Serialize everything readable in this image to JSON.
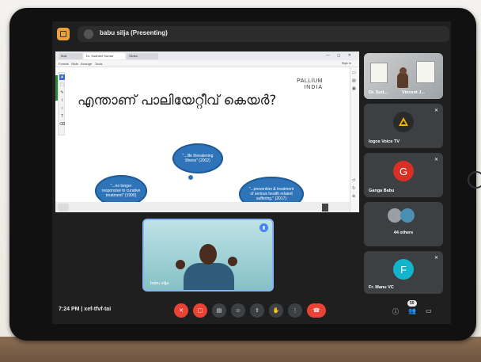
{
  "header": {
    "presenting_label": "babu silja (Presenting)"
  },
  "slide": {
    "browser_tabs": [
      "Mail",
      "Dr. Sudheer Kumar",
      "Slides"
    ],
    "window_controls": "— ◻ ✕",
    "menu": [
      "Format",
      "Slide",
      "Arrange",
      "Tools"
    ],
    "toolbar_right": "Sign in",
    "title_malayalam": "എന്താണ് പാലിയേറ്റീവ് കെയർ?",
    "logo_line1": "PALLIUM",
    "logo_line2": "INDIA",
    "clouds": [
      {
        "text": "\"...life threatening illness\" (2002)"
      },
      {
        "text": "\"...no longer responsive to curative treatment\" (1990)"
      },
      {
        "text": "\"...prevention & treatment of serious health related suffering.\" (2017)"
      }
    ]
  },
  "tiles": [
    {
      "name": "Dr. Sud...",
      "secondary": "Vincent J...",
      "type": "photo"
    },
    {
      "name": "logos Voice TV",
      "avatar_letter": "",
      "avatar_color": "#2a2a2a",
      "type": "logo"
    },
    {
      "name": "Ganga Babu",
      "avatar_letter": "G",
      "avatar_color": "#d93025",
      "type": "avatar"
    },
    {
      "name": "44 others",
      "type": "others"
    },
    {
      "name": "Fr. Manu VC",
      "avatar_letter": "F",
      "avatar_color": "#12b5cb",
      "type": "avatar"
    }
  ],
  "self_view": {
    "name": "babu silja"
  },
  "bottom": {
    "meeting_info": "7:24 PM  |  xef-tfvf-tai",
    "participant_count": "50"
  },
  "colors": {
    "accent_red": "#ea4335",
    "cloud_blue": "#2f74b8",
    "self_view_border": "#8ab4f8"
  }
}
